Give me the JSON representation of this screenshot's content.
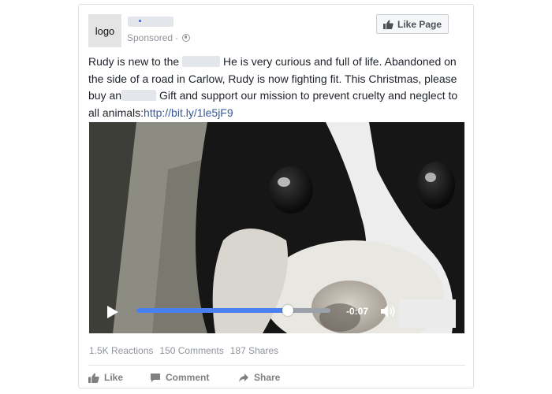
{
  "header": {
    "avatar_text": "logo",
    "sponsored_label": "Sponsored",
    "separator": "·",
    "like_page_label": "Like Page"
  },
  "post": {
    "text_part1": "Rudy is new to the",
    "text_part2": "He is very curious and full of life. Abandoned on the side of a road in Carlow, Rudy is now fighting fit. This Christmas, please buy an",
    "text_part3": "Gift and support our mission to prevent cruelty and neglect to all animals:",
    "link": "http://bit.ly/1le5jF9"
  },
  "video": {
    "time_remaining": "-0:07",
    "progress": 0.78
  },
  "stats": {
    "reactions": "1.5K Reactions",
    "comments": "150 Comments",
    "shares": "187 Shares"
  },
  "actions": {
    "like": "Like",
    "comment": "Comment",
    "share": "Share"
  },
  "colors": {
    "link": "#365899",
    "progress_fill": "#4a7ff0",
    "border": "#dddfe2"
  }
}
